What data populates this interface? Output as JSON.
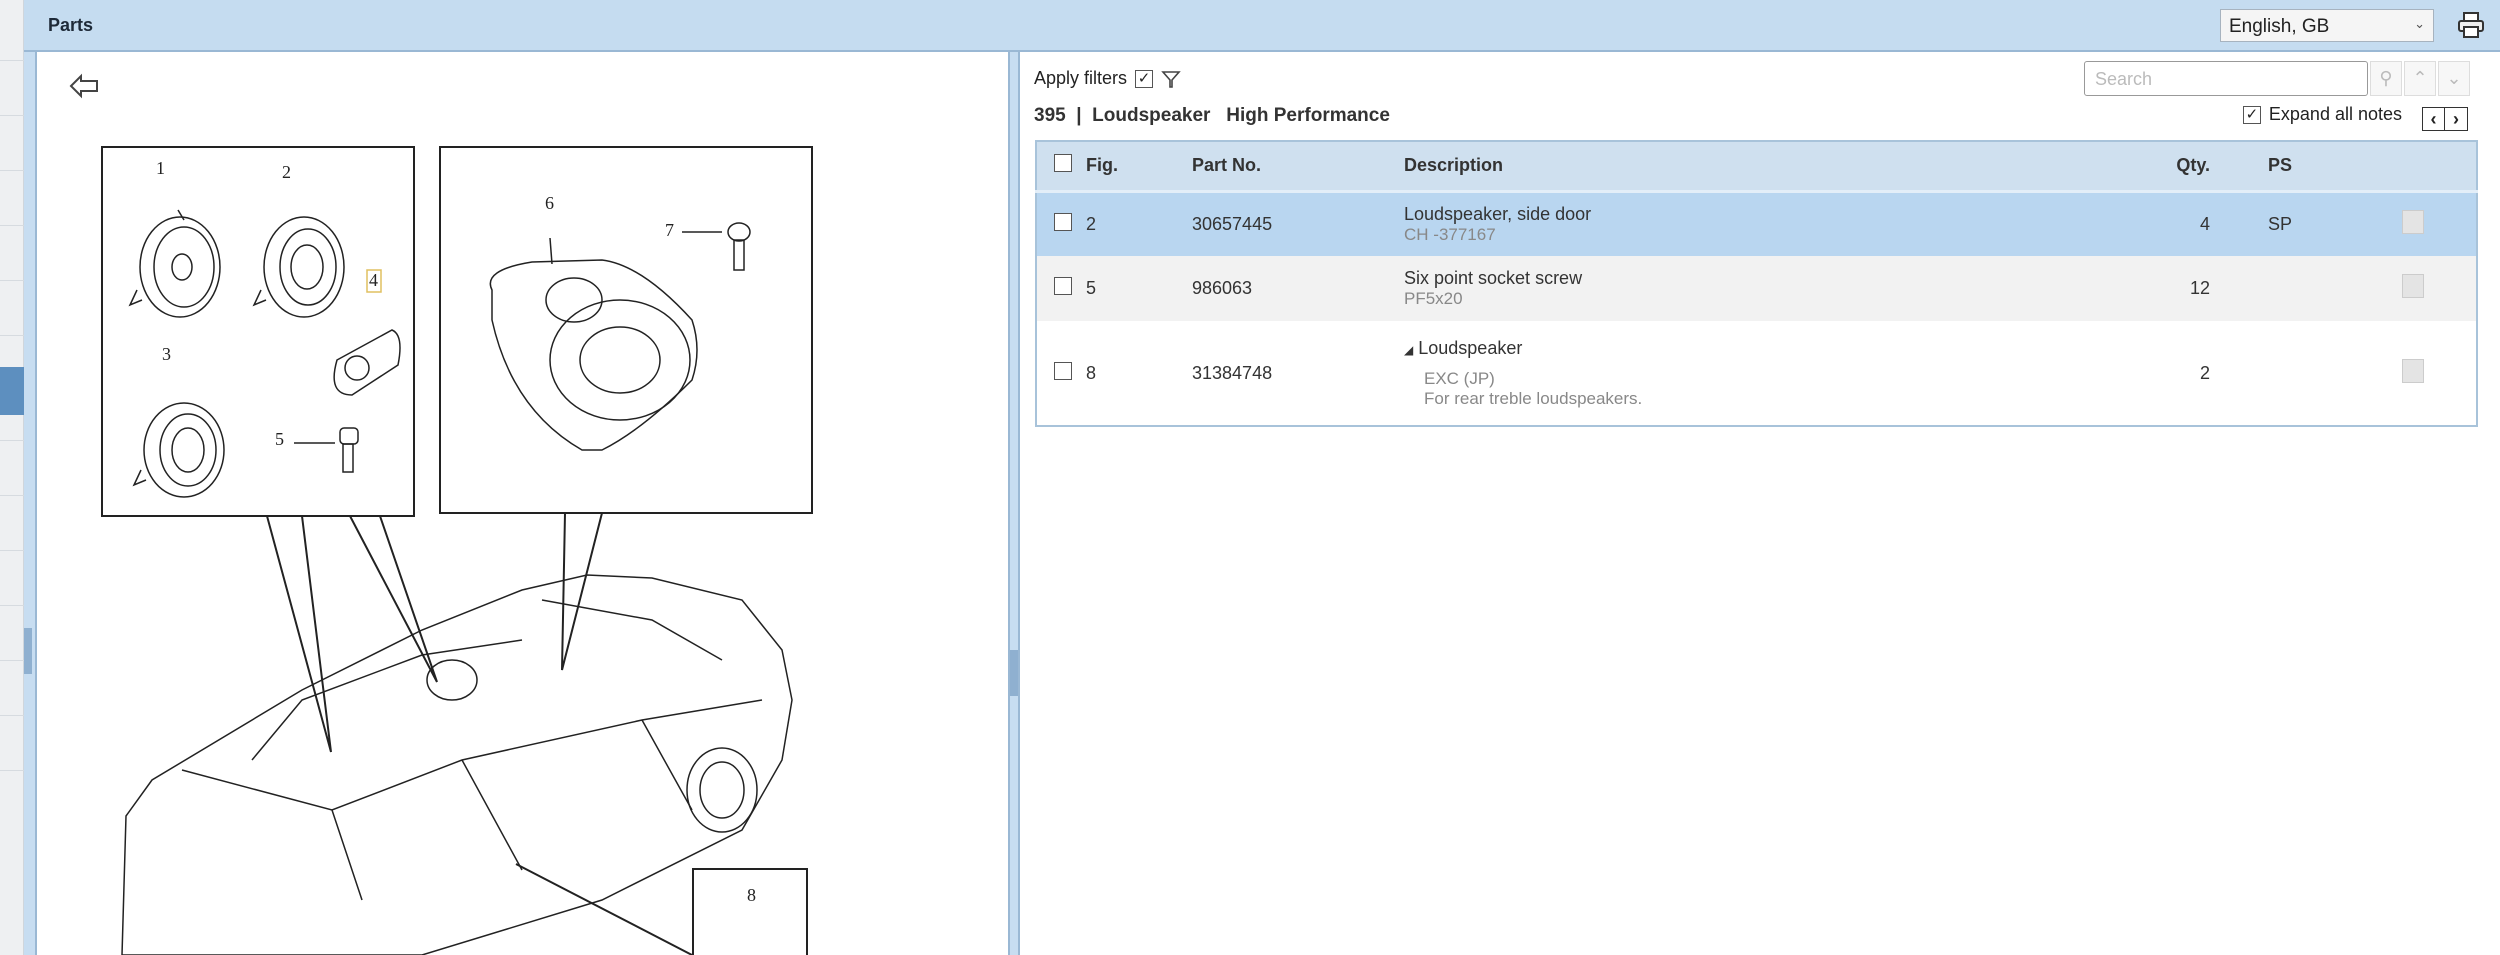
{
  "header": {
    "title": "Parts",
    "language": "English, GB"
  },
  "toolbar": {
    "apply_filters": "Apply filters",
    "apply_filters_checked": true,
    "search_placeholder": "Search",
    "expand_all_notes": "Expand all notes",
    "expand_checked": true
  },
  "breadcrumb": {
    "number": "395",
    "separator": "|",
    "group": "Loudspeaker",
    "variant": "High Performance"
  },
  "table": {
    "headers": {
      "fig": "Fig.",
      "part_no": "Part No.",
      "description": "Description",
      "qty": "Qty.",
      "ps": "PS"
    },
    "rows": [
      {
        "fig": "2",
        "part_no": "30657445",
        "description": "Loudspeaker, side door",
        "sub": "CH -377167",
        "qty": "4",
        "ps": "SP"
      },
      {
        "fig": "5",
        "part_no": "986063",
        "description": "Six point socket screw",
        "sub": "PF5x20",
        "qty": "12",
        "ps": ""
      },
      {
        "fig": "8",
        "part_no": "31384748",
        "description": "Loudspeaker",
        "sub": "EXC (JP)",
        "note": "For rear treble loudspeakers.",
        "qty": "2",
        "ps": ""
      }
    ]
  },
  "diagram": {
    "labels": [
      "1",
      "2",
      "3",
      "4",
      "5",
      "6",
      "7",
      "8"
    ]
  }
}
